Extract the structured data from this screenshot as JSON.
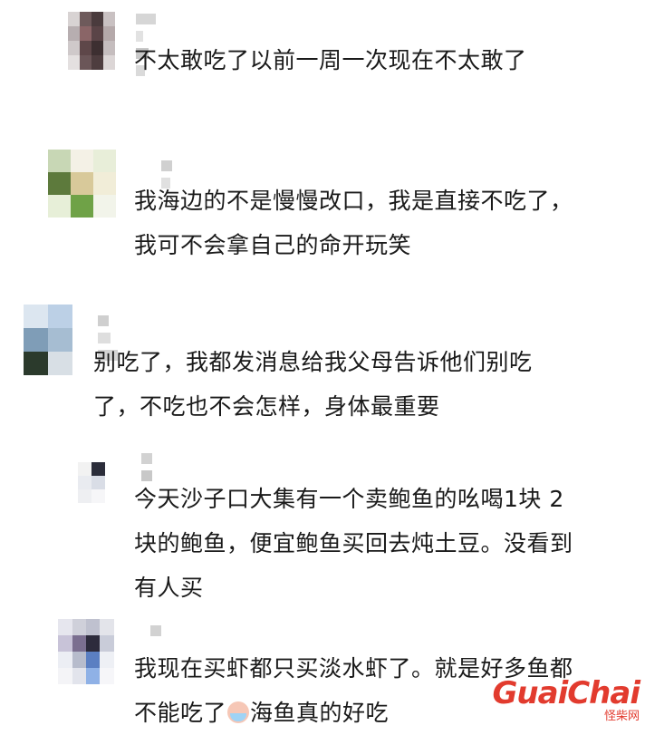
{
  "comments": [
    {
      "text_lines": [
        "不太敢吃了以前一周一次现在不太敢了"
      ]
    },
    {
      "text_lines": [
        "我海边的不是慢慢改口，我是直接不吃了，",
        "我可不会拿自己的命开玩笑"
      ]
    },
    {
      "text_lines": [
        "别吃了，我都发消息给我父母告诉他们别吃",
        "了，不吃也不会怎样，身体最重要"
      ]
    },
    {
      "text_lines": [
        "今天沙子口大集有一个卖鲍鱼的吆喝1块 2",
        "块的鲍鱼，便宜鲍鱼买回去炖土豆。没看到",
        "有人买"
      ]
    },
    {
      "text_lines": [
        "我现在买虾都只买淡水虾了。就是好多鱼都",
        "不能吃了"
      ],
      "line2_suffix": "海鱼真的好吃",
      "emoji": "laughing-cry-emoji"
    }
  ],
  "watermark": {
    "brand_part1": "Guai",
    "brand_part2": "Chai",
    "site": "怪柴网",
    "color": "#e23b2e"
  }
}
